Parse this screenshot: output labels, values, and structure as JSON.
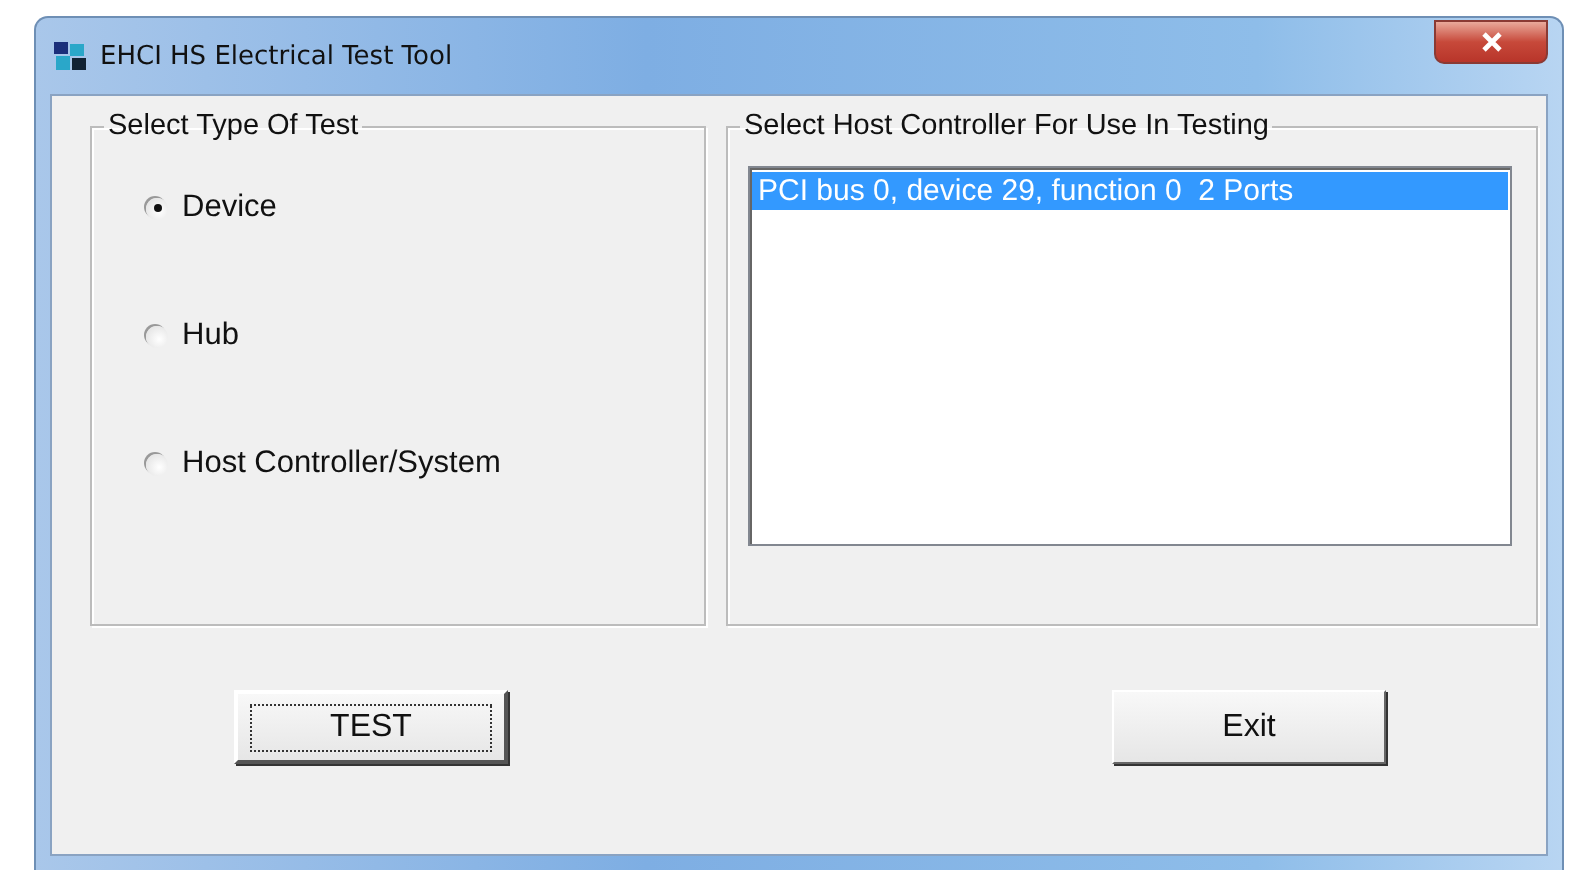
{
  "window": {
    "title": "EHCI HS Electrical Test Tool"
  },
  "test_type": {
    "title": "Select Type Of Test",
    "options": [
      {
        "label": "Device",
        "selected": true
      },
      {
        "label": "Hub",
        "selected": false
      },
      {
        "label": "Host Controller/System",
        "selected": false
      }
    ]
  },
  "host_controller": {
    "title": "Select Host Controller For Use In Testing",
    "items": [
      {
        "label": "PCI bus 0, device 29, function 0  2 Ports",
        "selected": true
      }
    ]
  },
  "buttons": [
    {
      "label": "TEST",
      "focused": true
    },
    {
      "label": "Exit",
      "focused": false
    }
  ]
}
